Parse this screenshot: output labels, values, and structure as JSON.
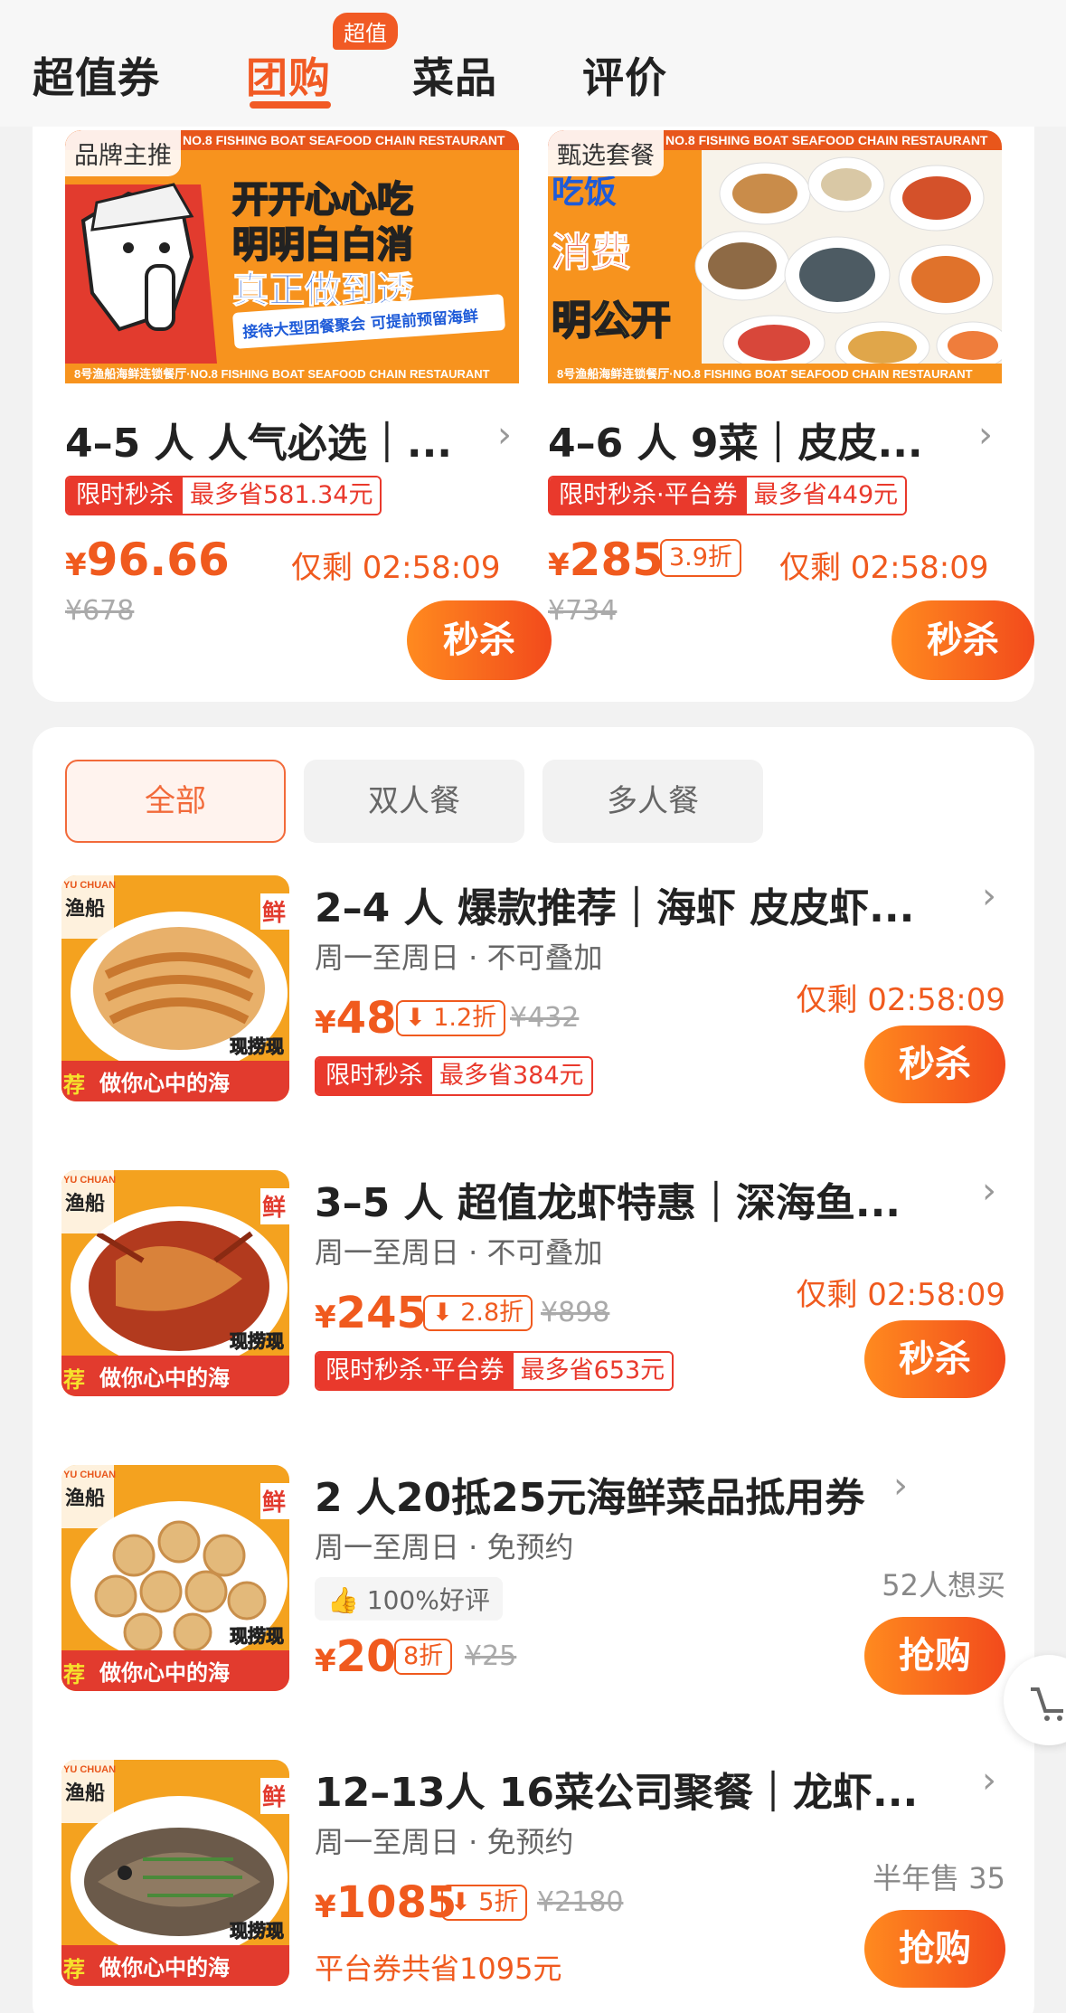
{
  "tabs": [
    {
      "label": "超值券"
    },
    {
      "label": "团购",
      "badge": "超值"
    },
    {
      "label": "菜品"
    },
    {
      "label": "评价"
    }
  ],
  "featured": [
    {
      "tag": "品牌主推",
      "banner_top": "NO.8 FISHING BOAT SEAFOOD CHAIN RESTAURANT",
      "banner_line1": "开开心心吃",
      "banner_line2": "明明白白消",
      "banner_line3": "真正做到透",
      "banner_note": "接待大型团餐聚会 可提前预留海鲜",
      "banner_footer": "8号渔船海鲜连锁餐厅·NO.8 FISHING BOAT SEAFOOD CHAIN RESTAURANT",
      "title": "4–5 人 人气必选｜...",
      "promo_tag": "限时秒杀",
      "promo_save": "最多省581.34元",
      "price_currency": "¥",
      "price": "96.66",
      "original": "¥678",
      "countdown": "仅剩 02:58:09",
      "button": "秒杀"
    },
    {
      "tag": "甄选套餐",
      "banner_top": "NO.8 FISHING BOAT SEAFOOD CHAIN RESTAURANT",
      "banner_line1": "吃饭",
      "banner_line2": "消费",
      "banner_line3": "明公开",
      "banner_footer": "8号渔船海鲜连锁餐厅·NO.8 FISHING BOAT SEAFOOD CHAIN RESTAURANT",
      "title": "4–6 人 9菜｜皮皮...",
      "promo_tag": "限时秒杀·平台券",
      "promo_save": "最多省449元",
      "price_currency": "¥",
      "price": "285",
      "discount": "3.9折",
      "original": "¥734",
      "countdown": "仅剩 02:58:09",
      "button": "秒杀"
    }
  ],
  "filters": [
    {
      "label": "全部"
    },
    {
      "label": "双人餐"
    },
    {
      "label": "多人餐"
    }
  ],
  "image_text": {
    "brand_en": "YU CHUAN",
    "brand": "渔船",
    "fresh": "鲜",
    "side": "现捞现",
    "recommend": "荐",
    "slogan": "做你心中的海"
  },
  "items": [
    {
      "title": "2–4 人 爆款推荐｜海虾 皮皮虾...",
      "sub": "周一至周日 · 不可叠加",
      "countdown": "仅剩 02:58:09",
      "price_currency": "¥",
      "price": "48",
      "discount": "1.2折",
      "original": "¥432",
      "promo_tag": "限时秒杀",
      "promo_save": "最多省384元",
      "button": "秒杀"
    },
    {
      "title": "3–5 人 超值龙虾特惠｜深海鱼...",
      "sub": "周一至周日 · 不可叠加",
      "countdown": "仅剩 02:58:09",
      "price_currency": "¥",
      "price": "245",
      "discount": "2.8折",
      "original": "¥898",
      "promo_tag": "限时秒杀·平台券",
      "promo_save": "最多省653元",
      "button": "秒杀"
    },
    {
      "title": "2 人20抵25元海鲜菜品抵用券",
      "sub": "周一至周日 · 免预约",
      "rating": "100%好评",
      "wants": "52人想买",
      "price_currency": "¥",
      "price": "20",
      "discount": "8折",
      "original": "¥25",
      "button": "抢购"
    },
    {
      "title": "12–13人 16菜公司聚餐｜龙虾...",
      "sub": "周一至周日 · 免预约",
      "sold": "半年售 35",
      "price_currency": "¥",
      "price": "1085",
      "discount": "5折",
      "original": "¥2180",
      "saving": "平台券共省1095元",
      "button": "抢购"
    }
  ],
  "colors": {
    "accent": "#f15a24",
    "red": "#e9392c"
  }
}
